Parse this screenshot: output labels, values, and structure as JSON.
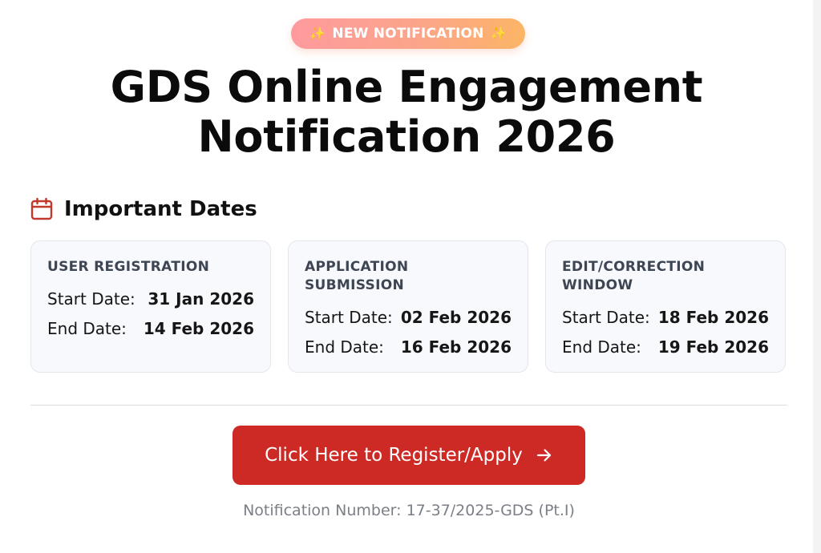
{
  "badge": {
    "text": "NEW NOTIFICATION",
    "icon": "sparkles-icon"
  },
  "heading": {
    "line1": "GDS Online Engagement",
    "line2": "Notification 2026"
  },
  "important_dates": {
    "title": "Important Dates",
    "icon": "calendar-icon",
    "cards": [
      {
        "title": "USER REGISTRATION",
        "start_label": "Start Date:",
        "start_value": "31 Jan 2026",
        "end_label": "End Date:",
        "end_value": "14 Feb 2026"
      },
      {
        "title": "APPLICATION SUBMISSION",
        "start_label": "Start Date:",
        "start_value": "02 Feb 2026",
        "end_label": "End Date:",
        "end_value": "16 Feb 2026"
      },
      {
        "title": "EDIT/CORRECTION WINDOW",
        "start_label": "Start Date:",
        "start_value": "18 Feb 2026",
        "end_label": "End Date:",
        "end_value": "19 Feb 2026"
      }
    ]
  },
  "cta": {
    "label": "Click Here to Register/Apply",
    "icon": "arrow-right-icon"
  },
  "footer": {
    "notification_number": "Notification Number: 17-37/2025-GDS (Pt.I)"
  },
  "colors": {
    "accent_red": "#cd2a26",
    "badge_gradient_start": "#fe9a9e",
    "badge_gradient_end": "#fbb566",
    "card_bg": "#f7f9fc",
    "calendar_icon": "#c0392b"
  }
}
